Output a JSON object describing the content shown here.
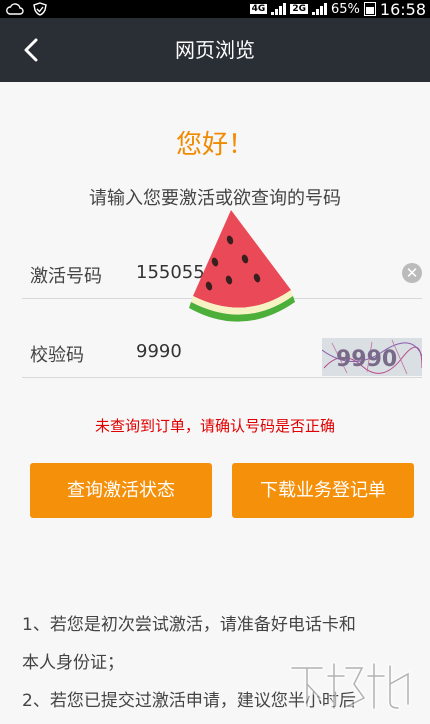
{
  "status_bar": {
    "battery": "65%",
    "time": "16:58",
    "network_1": "4G",
    "network_2": "2G"
  },
  "nav": {
    "title": "网页浏览"
  },
  "main": {
    "greeting": "您好！",
    "subtitle": "请输入您要激活或欲查询的号码",
    "activation_label": "激活号码",
    "activation_value": "155055",
    "captcha_label": "校验码",
    "captcha_value": "9990",
    "captcha_image_text": "9990",
    "error": "未查询到订单，请确认号码是否正确",
    "query_button": "查询激活状态",
    "download_button": "下载业务登记单"
  },
  "notes": {
    "line1": "1、若您是初次尝试激活，请准备好电话卡和",
    "line2": "本人身份证；",
    "line3": "2、若您已提交过激活申请，建议您半小时后"
  },
  "colors": {
    "accent": "#f5900a",
    "heading": "#f08a00",
    "error": "#e00000",
    "navbar": "#2a2f36"
  }
}
